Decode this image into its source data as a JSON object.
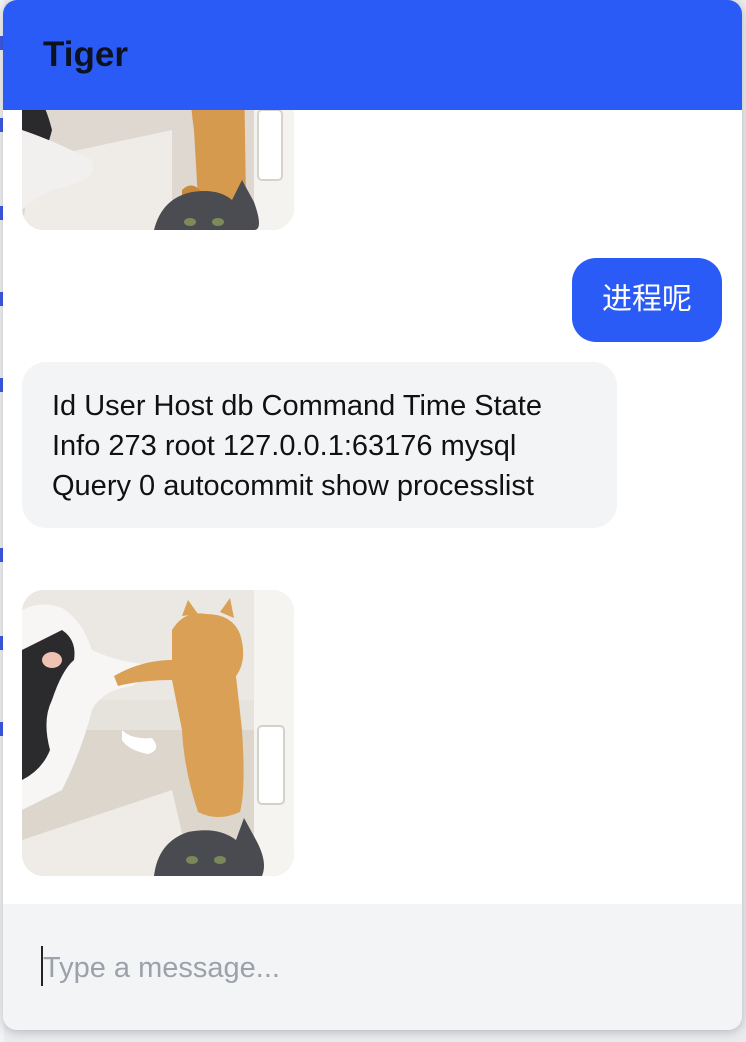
{
  "chat": {
    "title": "Tiger"
  },
  "messages": [
    {
      "sender": "bot",
      "type": "image",
      "content": "cat-fight-gif"
    },
    {
      "sender": "user",
      "type": "text",
      "text": "进程呢"
    },
    {
      "sender": "bot",
      "type": "text",
      "text": "Id User Host db Command Time State Info 273 root 127.0.0.1:63176 mysql Query 0 autocommit show processlist"
    },
    {
      "sender": "bot",
      "type": "image",
      "content": "cat-fight-gif"
    }
  ],
  "composer": {
    "placeholder": "Type a message..."
  },
  "colors": {
    "accent": "#2a5bf6",
    "bot_bubble": "#f3f4f6",
    "input_bar": "#f3f4f6"
  }
}
